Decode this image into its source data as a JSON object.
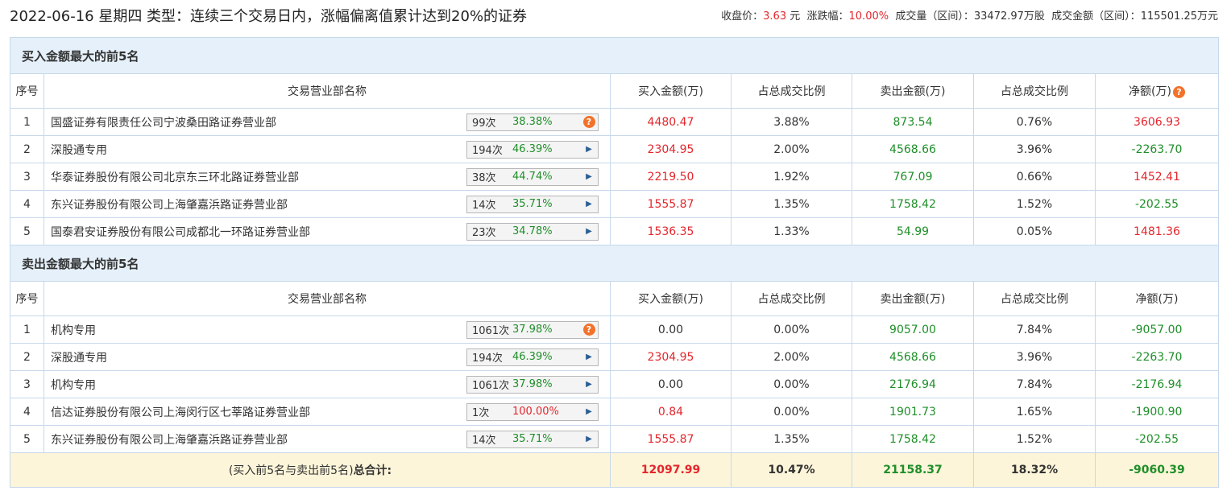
{
  "header": {
    "title": "2022-06-16 星期四 类型：连续三个交易日内，涨幅偏离值累计达到20%的证券",
    "close_label": "收盘价：",
    "close_value": "3.63",
    "close_unit": " 元",
    "change_label": "涨跌幅：",
    "change_value": "10.00%",
    "volume_label": "成交量（区间）：",
    "volume_value": "33472.97万股",
    "amount_label": "成交金额（区间）：",
    "amount_value": "115501.25万元"
  },
  "columns": {
    "seq": "序号",
    "name": "交易营业部名称",
    "buy": "买入金额(万)",
    "buy_ratio": "占总成交比例",
    "sell": "卖出金额(万)",
    "sell_ratio": "占总成交比例",
    "net": "净额(万)"
  },
  "buy_section": {
    "title": "买入金额最大的前5名",
    "rows": [
      {
        "seq": "1",
        "name": "国盛证券有限责任公司宁波桑田路证券营业部",
        "count": "99次",
        "rate": "38.38%",
        "rate_color": "green",
        "icon": "help",
        "buy": "4480.47",
        "buy_ratio": "3.88%",
        "sell": "873.54",
        "sell_ratio": "0.76%",
        "net": "3606.93",
        "net_color": "red"
      },
      {
        "seq": "2",
        "name": "深股通专用",
        "count": "194次",
        "rate": "46.39%",
        "rate_color": "green",
        "icon": "arrow",
        "buy": "2304.95",
        "buy_ratio": "2.00%",
        "sell": "4568.66",
        "sell_ratio": "3.96%",
        "net": "-2263.70",
        "net_color": "green"
      },
      {
        "seq": "3",
        "name": "华泰证券股份有限公司北京东三环北路证券营业部",
        "count": "38次",
        "rate": "44.74%",
        "rate_color": "green",
        "icon": "arrow",
        "buy": "2219.50",
        "buy_ratio": "1.92%",
        "sell": "767.09",
        "sell_ratio": "0.66%",
        "net": "1452.41",
        "net_color": "red"
      },
      {
        "seq": "4",
        "name": "东兴证券股份有限公司上海肇嘉浜路证券营业部",
        "count": "14次",
        "rate": "35.71%",
        "rate_color": "green",
        "icon": "arrow",
        "buy": "1555.87",
        "buy_ratio": "1.35%",
        "sell": "1758.42",
        "sell_ratio": "1.52%",
        "net": "-202.55",
        "net_color": "green"
      },
      {
        "seq": "5",
        "name": "国泰君安证券股份有限公司成都北一环路证券营业部",
        "count": "23次",
        "rate": "34.78%",
        "rate_color": "green",
        "icon": "arrow",
        "buy": "1536.35",
        "buy_ratio": "1.33%",
        "sell": "54.99",
        "sell_ratio": "0.05%",
        "net": "1481.36",
        "net_color": "red"
      }
    ]
  },
  "sell_section": {
    "title": "卖出金额最大的前5名",
    "rows": [
      {
        "seq": "1",
        "name": "机构专用",
        "count": "1061次",
        "rate": "37.98%",
        "rate_color": "green",
        "icon": "help",
        "buy": "0.00",
        "buy_color": "black",
        "buy_ratio": "0.00%",
        "sell": "9057.00",
        "sell_ratio": "7.84%",
        "net": "-9057.00",
        "net_color": "green"
      },
      {
        "seq": "2",
        "name": "深股通专用",
        "count": "194次",
        "rate": "46.39%",
        "rate_color": "green",
        "icon": "arrow",
        "buy": "2304.95",
        "buy_color": "red",
        "buy_ratio": "2.00%",
        "sell": "4568.66",
        "sell_ratio": "3.96%",
        "net": "-2263.70",
        "net_color": "green"
      },
      {
        "seq": "3",
        "name": "机构专用",
        "count": "1061次",
        "rate": "37.98%",
        "rate_color": "green",
        "icon": "arrow",
        "buy": "0.00",
        "buy_color": "black",
        "buy_ratio": "0.00%",
        "sell": "2176.94",
        "sell_ratio": "7.84%",
        "net": "-2176.94",
        "net_color": "green"
      },
      {
        "seq": "4",
        "name": "信达证券股份有限公司上海闵行区七莘路证券营业部",
        "count": "1次",
        "rate": "100.00%",
        "rate_color": "red",
        "icon": "arrow",
        "buy": "0.84",
        "buy_color": "red",
        "buy_ratio": "0.00%",
        "sell": "1901.73",
        "sell_ratio": "1.65%",
        "net": "-1900.90",
        "net_color": "green"
      },
      {
        "seq": "5",
        "name": "东兴证券股份有限公司上海肇嘉浜路证券营业部",
        "count": "14次",
        "rate": "35.71%",
        "rate_color": "green",
        "icon": "arrow",
        "buy": "1555.87",
        "buy_color": "red",
        "buy_ratio": "1.35%",
        "sell": "1758.42",
        "sell_ratio": "1.52%",
        "net": "-202.55",
        "net_color": "green"
      }
    ]
  },
  "total": {
    "label_prefix": "(买入前5名与卖出前5名)",
    "label_bold": "总合计:",
    "buy": "12097.99",
    "buy_ratio": "10.47%",
    "sell": "21158.37",
    "sell_ratio": "18.32%",
    "net": "-9060.39"
  },
  "icons": {
    "help": "question-icon",
    "arrow": "triangle-right-icon"
  },
  "colors": {
    "red": "#e4262c",
    "green": "#1f8f29",
    "section_bg": "#e5f0fa",
    "total_bg": "#fcf5d9",
    "border": "#c7d8ea",
    "help_icon": "#f2722b"
  }
}
